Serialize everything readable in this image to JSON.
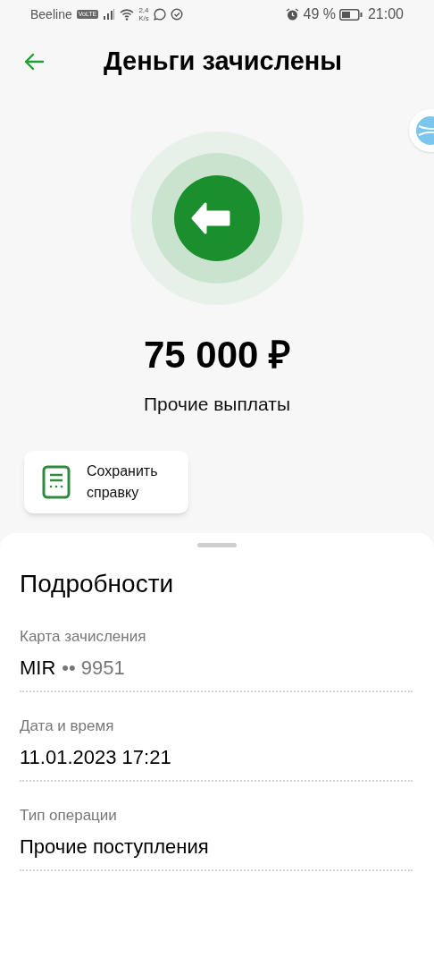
{
  "status_bar": {
    "carrier": "Beeline",
    "volte_badge": "VoLTE",
    "speed_value": "2,4",
    "speed_unit": "K/s",
    "battery_percent": "49 %",
    "time": "21:00"
  },
  "header": {
    "title": "Деньги зачислены"
  },
  "payment": {
    "amount": "75 000 ₽",
    "category": "Прочие выплаты"
  },
  "save_button": {
    "label": "Сохранить справку"
  },
  "details": {
    "title": "Подробности",
    "rows": [
      {
        "kind": "card",
        "label": "Карта зачисления",
        "card_brand": "MIR",
        "card_mask": "•• 9951"
      },
      {
        "kind": "text",
        "label": "Дата и время",
        "value": "11.01.2023 17:21"
      },
      {
        "kind": "text",
        "label": "Тип операции",
        "value": "Прочие поступления"
      }
    ]
  }
}
